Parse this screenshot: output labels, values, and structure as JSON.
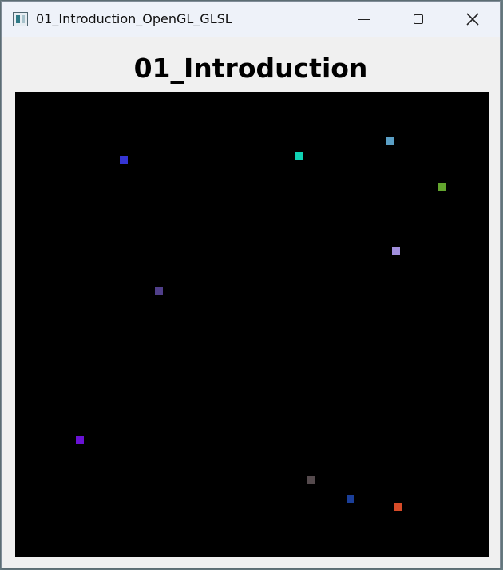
{
  "window": {
    "title": "01_Introduction_OpenGL_GLSL",
    "icon": "opengl-app-icon",
    "controls": {
      "minimize_icon": "minimize-icon",
      "maximize_icon": "maximize-icon",
      "close_icon": "close-icon"
    }
  },
  "main": {
    "heading": "01_Introduction",
    "canvas_background": "#000000",
    "point_colors": [
      "#3535d4",
      "#10d2b4",
      "#5b9fc5",
      "#63a52e",
      "#a18fdd",
      "#503f8a",
      "#6912d4",
      "#554a4d",
      "#1b3f99",
      "#d64b28"
    ]
  }
}
